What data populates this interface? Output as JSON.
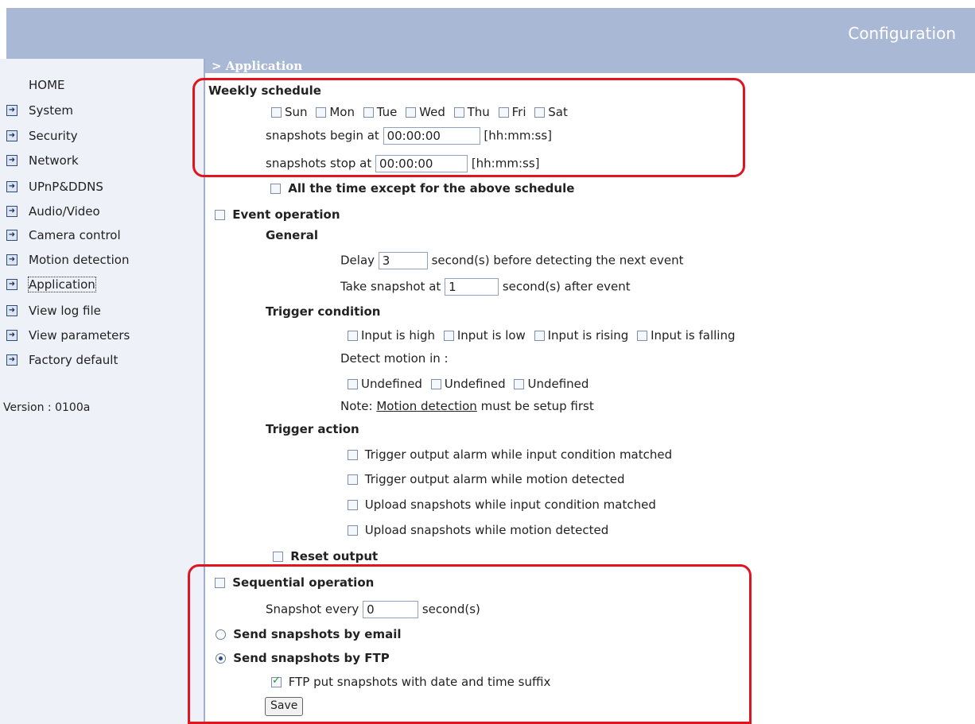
{
  "header": {
    "title": "Configuration"
  },
  "sidebar": {
    "home": "HOME",
    "items": [
      {
        "label": "System"
      },
      {
        "label": "Security"
      },
      {
        "label": "Network"
      },
      {
        "label": "UPnP&DDNS"
      },
      {
        "label": "Audio/Video"
      },
      {
        "label": "Camera control"
      },
      {
        "label": "Motion detection"
      },
      {
        "label": "Application"
      },
      {
        "label": "View log file"
      },
      {
        "label": "View parameters"
      },
      {
        "label": "Factory default"
      }
    ],
    "active": "Application",
    "version": "Version : 0100a"
  },
  "content": {
    "breadcrumb": "> Application",
    "weekly": {
      "title": "Weekly schedule",
      "days": [
        "Sun",
        "Mon",
        "Tue",
        "Wed",
        "Thu",
        "Fri",
        "Sat"
      ],
      "begin_label": "snapshots begin at",
      "begin_value": "00:00:00",
      "stop_label": "snapshots stop at",
      "stop_value": "00:00:00",
      "format": "[hh:mm:ss]",
      "except_label": "All the time except for the above schedule"
    },
    "event": {
      "label": "Event operation",
      "general": "General",
      "delay_label": "Delay",
      "delay_value": "3",
      "delay_suffix": "second(s) before detecting the next event",
      "take_label": "Take snapshot at",
      "take_value": "1",
      "take_suffix": "second(s) after event",
      "trigger_condition": "Trigger condition",
      "inputs": [
        "Input is high",
        "Input is low",
        "Input is rising",
        "Input is falling"
      ],
      "detect_label": "Detect motion in :",
      "motion": [
        "Undefined",
        "Undefined",
        "Undefined"
      ],
      "note_prefix": "Note:",
      "note_link": "Motion detection",
      "note_suffix": "must be setup first",
      "trigger_action": "Trigger action",
      "actions": [
        "Trigger output alarm while input condition matched",
        "Trigger output alarm while motion detected",
        "Upload snapshots while input condition matched",
        "Upload snapshots while motion detected"
      ],
      "reset_label": "Reset output"
    },
    "sequential": {
      "label": "Sequential operation",
      "every_label": "Snapshot every",
      "every_value": "0",
      "every_suffix": "second(s)"
    },
    "send": {
      "email_label": "Send snapshots by email",
      "ftp_label": "Send snapshots by FTP",
      "ftp_suffix_label": "FTP put snapshots with date and time suffix",
      "ftp_suffix_checked": true,
      "selected": "FTP"
    },
    "save_label": "Save"
  }
}
